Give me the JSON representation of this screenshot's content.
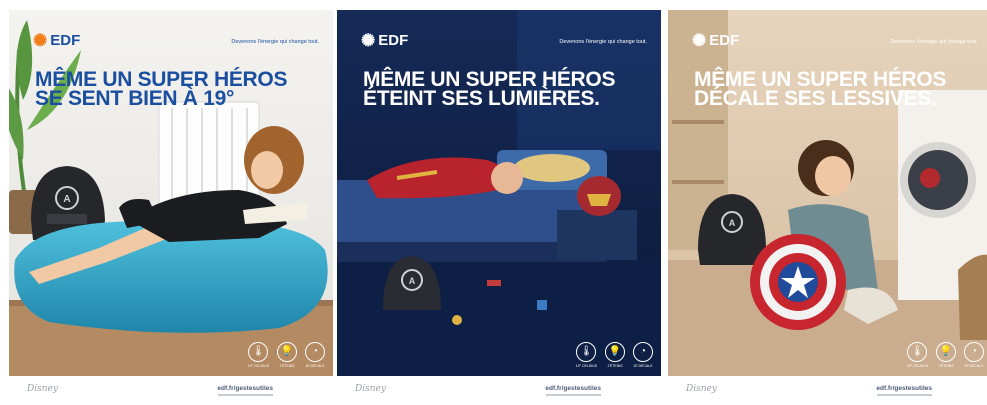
{
  "brand": "EDF",
  "tagline": "Devenons l'énergie qui change tout.",
  "url": "edf.fr/gestesutiles",
  "footer_logo": "Disney",
  "icons": [
    {
      "name": "thermometer-icon",
      "label": "19° CELSIUS"
    },
    {
      "name": "lightbulb-icon",
      "label": "J'ÉTEINS"
    },
    {
      "name": "timer-icon",
      "label": "JE DÉCALE"
    }
  ],
  "posters": [
    {
      "headline_line1": "MÊME UN SUPER HÉROS",
      "headline_line2": "SE SENT BIEN À 19°",
      "theme": "day",
      "headline_color": "#1a4fa0"
    },
    {
      "headline_line1": "MÊME UN SUPER HÉROS",
      "headline_line2": "ÉTEINT SES LUMIÈRES.",
      "theme": "night",
      "headline_color": "#ffffff"
    },
    {
      "headline_line1": "MÊME UN SUPER HÉROS",
      "headline_line2": "DÉCALE SES LESSIVES.",
      "theme": "day",
      "headline_color": "#ffffff"
    }
  ],
  "colors": {
    "edf_blue": "#1a4fa0",
    "edf_orange": "#f07d1a",
    "beanbag": "#2fa0c0"
  }
}
